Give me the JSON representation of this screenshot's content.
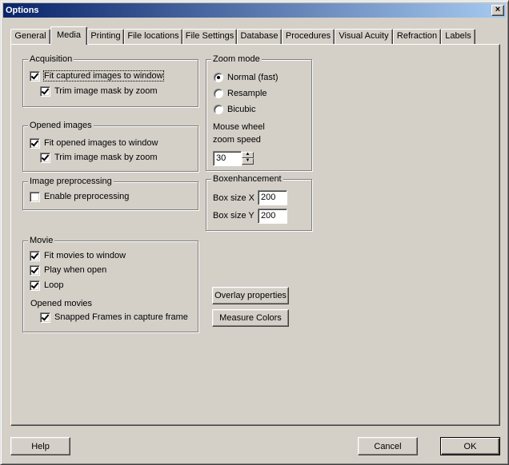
{
  "window": {
    "title": "Options",
    "close_label": "×"
  },
  "tabs": [
    {
      "label": "General"
    },
    {
      "label": "Media"
    },
    {
      "label": "Printing"
    },
    {
      "label": "File locations"
    },
    {
      "label": "File Settings"
    },
    {
      "label": "Database"
    },
    {
      "label": "Procedures"
    },
    {
      "label": "Visual Acuity"
    },
    {
      "label": "Refraction"
    },
    {
      "label": "Labels"
    }
  ],
  "active_tab": "Media",
  "acquisition": {
    "title": "Acquisition",
    "fit_captured": {
      "label": "Fit captured images to window",
      "checked": true
    },
    "trim_mask": {
      "label": "Trim image mask by zoom",
      "checked": true
    }
  },
  "opened_images": {
    "title": "Opened images",
    "fit_opened": {
      "label": "Fit opened images to window",
      "checked": true
    },
    "trim_mask": {
      "label": "Trim image mask by zoom",
      "checked": true
    }
  },
  "preprocessing": {
    "title": "Image preprocessing",
    "enable": {
      "label": "Enable preprocessing",
      "checked": false
    }
  },
  "movie": {
    "title": "Movie",
    "fit_movies": {
      "label": "Fit movies to window",
      "checked": true
    },
    "play_open": {
      "label": "Play when open",
      "checked": true
    },
    "loop": {
      "label": "Loop",
      "checked": true
    },
    "opened_movies_label": "Opened movies",
    "snapped_frames": {
      "label": "Snapped Frames in capture frame",
      "checked": true
    }
  },
  "zoom_mode": {
    "title": "Zoom mode",
    "options": [
      {
        "label": "Normal (fast)",
        "selected": true
      },
      {
        "label": "Resample",
        "selected": false
      },
      {
        "label": "Bicubic",
        "selected": false
      }
    ],
    "mouse_wheel_label_1": "Mouse wheel",
    "mouse_wheel_label_2": "zoom speed",
    "zoom_speed_value": "30"
  },
  "box_enhancement": {
    "title": "Boxenhancement",
    "size_x_label": "Box size X",
    "size_x_value": "200",
    "size_y_label": "Box size Y",
    "size_y_value": "200"
  },
  "buttons": {
    "overlay": "Overlay properties",
    "measure_colors": "Measure Colors",
    "help": "Help",
    "cancel": "Cancel",
    "ok": "OK"
  },
  "colors": {
    "face": "#d4d0c8",
    "title_start": "#0a246a",
    "title_end": "#a6caf0"
  }
}
